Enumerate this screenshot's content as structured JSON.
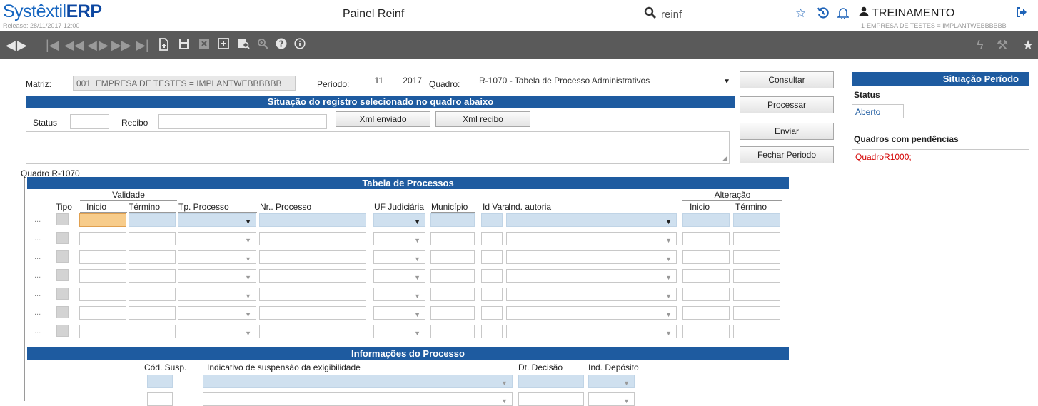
{
  "header": {
    "logo_light": "Systêxtil",
    "logo_bold": "ERP",
    "release": "Release: 28/11/2017 12:00",
    "title": "Painel Reinf",
    "search_value": "reinf",
    "user": "TREINAMENTO",
    "company": "1-EMPRESA DE TESTES = IMPLANTWEBBBBBB"
  },
  "form": {
    "matriz_label": "Matriz:",
    "matriz_code": "001",
    "matriz_name": "EMPRESA DE TESTES = IMPLANTWEBBBBBB",
    "periodo_label": "Período:",
    "periodo_mes": "11",
    "periodo_ano": "2017",
    "quadro_label": "Quadro:",
    "quadro_value": "R-1070 - Tabela de Processo Administrativos",
    "situacao_bar": "Situação do registro selecionado no quadro abaixo",
    "status_label": "Status",
    "recibo_label": "Recibo",
    "xml_enviado": "Xml enviado",
    "xml_recibo": "Xml recibo"
  },
  "actions": {
    "consultar": "Consultar",
    "processar": "Processar",
    "enviar": "Enviar",
    "fechar_periodo": "Fechar Periodo"
  },
  "side": {
    "title": "Situação Período",
    "status_label": "Status",
    "status_value": "Aberto",
    "pendencias_label": "Quadros com pendências",
    "pendencias_value": "QuadroR1000;"
  },
  "quadro": {
    "legend": "Quadro R-1070",
    "tabela_bar": "Tabela de Processos",
    "validade": "Validade",
    "alteracao": "Alteração",
    "columns": {
      "tipo": "Tipo",
      "inicio": "Inicio",
      "termino": "Término",
      "tp_processo": "Tp. Processo",
      "nr_processo": "Nr.. Processo",
      "uf": "UF Judiciária",
      "municipio": "Município",
      "id_vara": "Id Vara",
      "ind_autoria": "Ind. autoria",
      "alt_inicio": "Inicio",
      "alt_termino": "Término"
    },
    "row_marker": "...",
    "row_count": 7
  },
  "info": {
    "bar": "Informações do Processo",
    "cod_susp": "Cód. Susp.",
    "indicativo": "Indicativo de suspensão da exigibilidade",
    "dt_decisao": "Dt. Decisão",
    "ind_deposito": "Ind. Depósito"
  }
}
